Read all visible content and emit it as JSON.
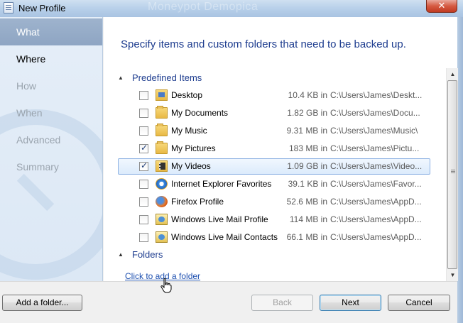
{
  "window": {
    "title": "New Profile",
    "background_title": "Moneypot Demopica",
    "close_glyph": "✕"
  },
  "nav": {
    "items": [
      {
        "label": "What",
        "state": "selected"
      },
      {
        "label": "Where",
        "state": "current"
      },
      {
        "label": "How",
        "state": "disabled"
      },
      {
        "label": "When",
        "state": "disabled"
      },
      {
        "label": "Advanced",
        "state": "disabled"
      },
      {
        "label": "Summary",
        "state": "disabled"
      }
    ]
  },
  "main": {
    "heading": "Specify items and custom folders that need to be backed up.",
    "groups": {
      "predefined": "Predefined Items",
      "folders": "Folders"
    },
    "add_folder_link": "Click to add a folder",
    "items": [
      {
        "name": "Desktop",
        "size": "10.4 KB in",
        "path": "C:\\Users\\James\\Deskt...",
        "checked": false,
        "icon": "desktop-folder-icon"
      },
      {
        "name": "My Documents",
        "size": "1.82 GB in",
        "path": "C:\\Users\\James\\Docu...",
        "checked": false,
        "icon": "documents-folder-icon"
      },
      {
        "name": "My Music",
        "size": "9.31 MB in",
        "path": "C:\\Users\\James\\Music\\",
        "checked": false,
        "icon": "music-folder-icon"
      },
      {
        "name": "My Pictures",
        "size": "183 MB in",
        "path": "C:\\Users\\James\\Pictu...",
        "checked": true,
        "icon": "pictures-folder-icon"
      },
      {
        "name": "My Videos",
        "size": "1.09 GB in",
        "path": "C:\\Users\\James\\Video...",
        "checked": true,
        "icon": "videos-folder-icon",
        "selected": true
      },
      {
        "name": "Internet Explorer Favorites",
        "size": "39.1 KB in",
        "path": "C:\\Users\\James\\Favor...",
        "checked": false,
        "icon": "internet-explorer-icon"
      },
      {
        "name": "Firefox Profile",
        "size": "52.6 MB in",
        "path": "C:\\Users\\James\\AppD...",
        "checked": false,
        "icon": "firefox-icon"
      },
      {
        "name": "Windows Live Mail Profile",
        "size": "114 MB in",
        "path": "C:\\Users\\James\\AppD...",
        "checked": false,
        "icon": "windows-live-mail-icon"
      },
      {
        "name": "Windows Live Mail Contacts",
        "size": "66.1 MB in",
        "path": "C:\\Users\\James\\AppD...",
        "checked": false,
        "icon": "windows-live-mail-icon"
      }
    ]
  },
  "buttons": {
    "add_folder": "Add a folder...",
    "back": "Back",
    "next": "Next",
    "cancel": "Cancel"
  }
}
